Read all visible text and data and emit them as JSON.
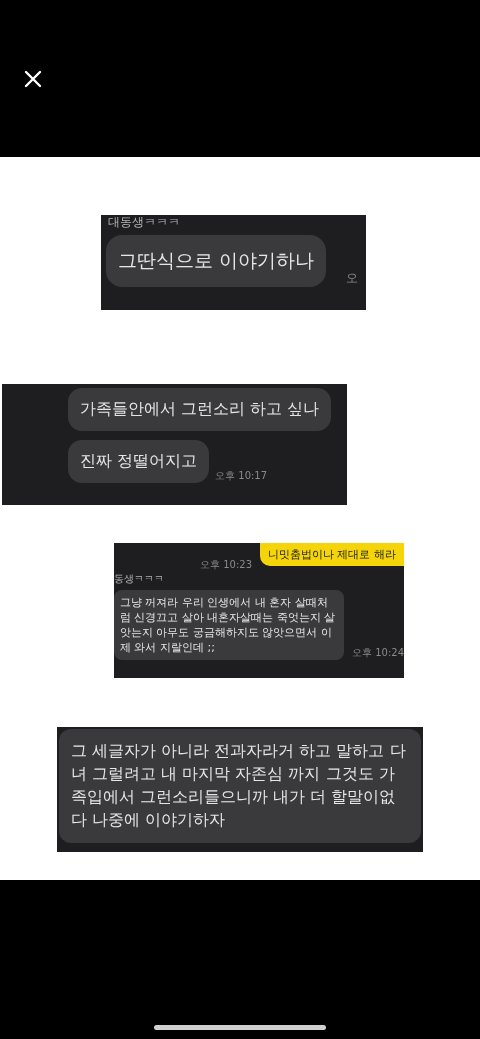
{
  "clips": [
    {
      "rows": [
        {
          "kind": "name",
          "text": "대동생ㅋㅋㅋ"
        },
        {
          "kind": "in",
          "text": "그딴식으로 이야기하나",
          "time": "오"
        }
      ]
    },
    {
      "rows": [
        {
          "kind": "in",
          "text": "가족들안에서 그런소리 하고 싶나"
        },
        {
          "kind": "in",
          "text": "진짜 정떨어지고",
          "time": "오후 10:17"
        }
      ]
    },
    {
      "rows": [
        {
          "kind": "out",
          "text": "니밋춤법이나 제대로 해라",
          "time": "오후 10:23"
        },
        {
          "kind": "name",
          "text": "동생ㅋㅋㅋ"
        },
        {
          "kind": "in",
          "text": "그냥 꺼져라 우리 인생에서 내 혼자 살때처럼 신경끄고 살아 내혼자살때는 죽엇는지 살앗는지 아무도 궁금해하지도 않앗으면서 이제 와서 지랄인데 ;;",
          "time": "오후 10:24"
        }
      ]
    },
    {
      "rows": [
        {
          "kind": "in",
          "text": "그 세글자가 아니라 전과자라거 하고 말하고 다녀 그럴려고 내 마지막 자존심 까지 그것도 가족입에서 그런소리들으니까 내가 더 할말이없다 나중에 이야기하자"
        }
      ]
    }
  ]
}
